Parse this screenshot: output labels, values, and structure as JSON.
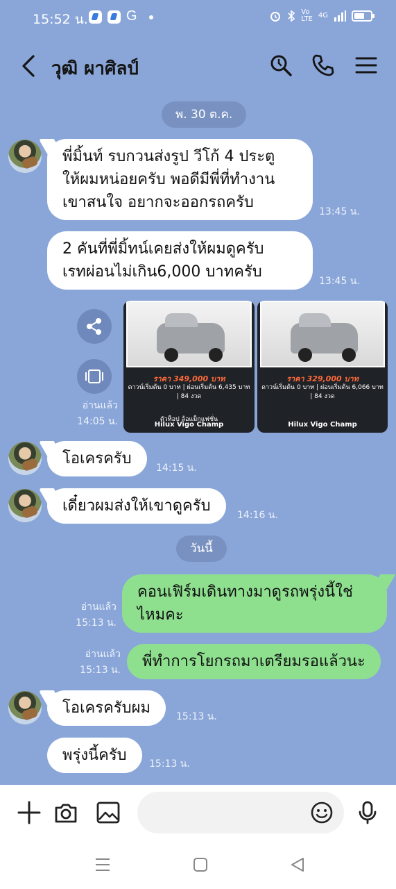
{
  "status_bar": {
    "time": "15:52 น.",
    "g_label": "G",
    "network": "4G"
  },
  "header": {
    "contact_name": "วุฒิ ผาศิลป์"
  },
  "chat": {
    "date_1": "พ. 30 ต.ค.",
    "date_2": "วันนี้",
    "messages": [
      {
        "lines": [
          "พี่มิ้นท์ รบกวนส่งรูป วีโก้ 4 ประตู",
          "ให้ผมหน่อยครับ พอดีมีพี่ที่ทำงาน",
          "เขาสนใจ อยากจะออกรถครับ"
        ],
        "time": "13:45 น."
      },
      {
        "lines": [
          "2 คันที่พี่มิ้ทน์เคยส่งให้ผมดูครับ",
          "เรทผ่อนไม่เกิน6,000 บาทครับ"
        ],
        "time": "13:45 น."
      },
      {
        "text": "โอเครครับ",
        "time": "14:15 น."
      },
      {
        "text": "เดี๋ยวผมส่งให้เขาดูครับ",
        "time": "14:16 น."
      },
      {
        "lines": [
          "คอนเฟิร์มเดินทางมาดูรถพรุ่งนี้ใช่",
          "ไหมคะ"
        ],
        "read": "อ่านแล้ว",
        "time": "15:13 น."
      },
      {
        "text": "พี่ทำการโยกรถมาเตรียมรอแล้วนะ",
        "read": "อ่านแล้ว",
        "time": "15:13 น."
      },
      {
        "text": "โอเครครับผม",
        "time": "15:13 น."
      },
      {
        "text": "พรุ่งนี้ครับ",
        "time": "15:13 น."
      }
    ],
    "photos": {
      "read": "อ่านแล้ว",
      "time": "14:05 น.",
      "cards": [
        {
          "price": "ราคา 349,000 บาท",
          "line1": "ดาวน์เริ่มต้น 0 บาท | ผ่อนเริ่มต้น 6,435 บาท | 84 งวด",
          "tag": "ตัวท็อป ล้อแม็กแฟชั่น",
          "model": "Hilux Vigo Champ"
        },
        {
          "price": "ราคา 329,000 บาท",
          "line1": "ดาวน์เริ่มต้น 0 บาท | ผ่อนเริ่มต้น 6,066 บาท | 84 งวด",
          "tag": "",
          "model": "Hilux Vigo Champ"
        }
      ]
    }
  },
  "input": {
    "placeholder": ""
  },
  "colors": {
    "chat_bg": "#8aa6d9",
    "outgoing_bubble": "#8ee08f",
    "incoming_bubble": "#ffffff"
  }
}
